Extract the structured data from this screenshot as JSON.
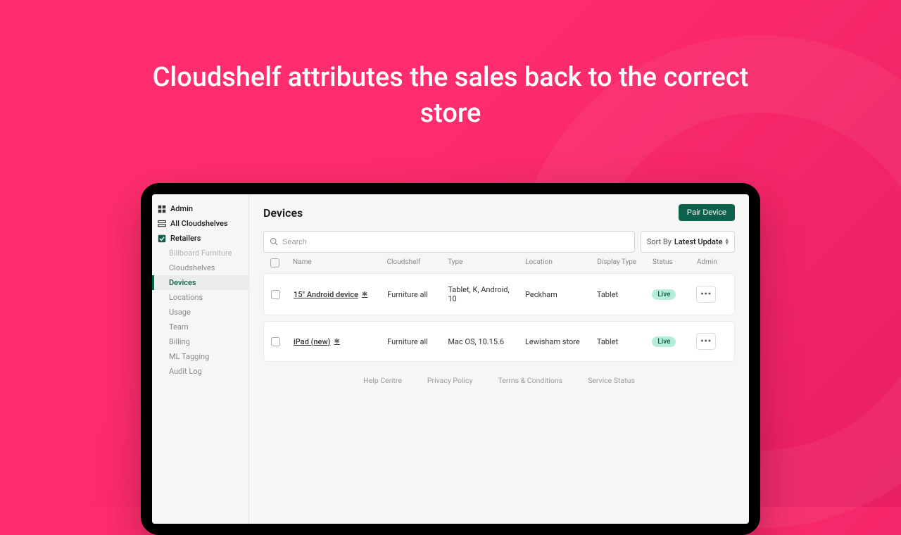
{
  "headline": "Cloudshelf attributes the sales back to the correct store",
  "sidebar": {
    "admin": "Admin",
    "all_cloudshelves": "All Cloudshelves",
    "retailers": "Retailers",
    "sub": {
      "billboard": "Billboard Furniture",
      "cloudshelves": "Cloudshelves",
      "devices": "Devices",
      "locations": "Locations",
      "usage": "Usage",
      "team": "Team",
      "billing": "Billing",
      "ml_tagging": "ML Tagging",
      "audit_log": "Audit Log"
    }
  },
  "main": {
    "title": "Devices",
    "pair_button": "Pair Device",
    "search_placeholder": "Search",
    "sort_label": "Sort By",
    "sort_value": "Latest Update",
    "columns": {
      "name": "Name",
      "cloudshelf": "Cloudshelf",
      "type": "Type",
      "location": "Location",
      "display_type": "Display Type",
      "status": "Status",
      "admin": "Admin"
    },
    "rows": [
      {
        "name": "15\" Android device",
        "cloudshelf": "Furniture all",
        "type": "Tablet, K, Android, 10",
        "location": "Peckham",
        "display_type": "Tablet",
        "status": "Live"
      },
      {
        "name": "iPad (new)",
        "cloudshelf": "Furniture all",
        "type": "Mac OS, 10.15.6",
        "location": "Lewisham store",
        "display_type": "Tablet",
        "status": "Live"
      }
    ]
  },
  "footer": {
    "help": "Help Centre",
    "privacy": "Privacy Policy",
    "terms": "Terms & Conditions",
    "status": "Service Status"
  }
}
